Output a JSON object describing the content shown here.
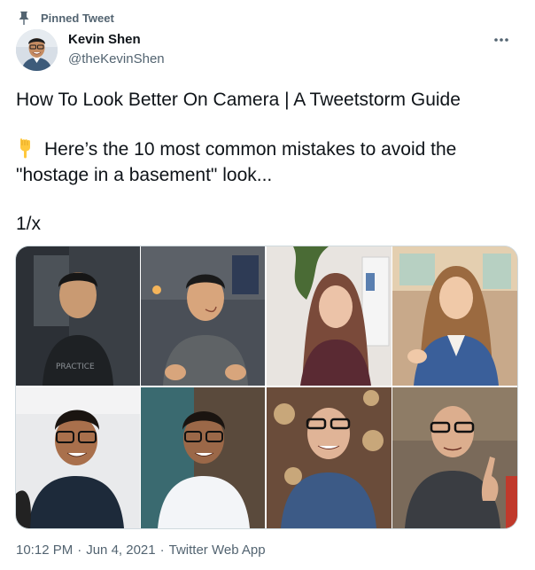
{
  "pinned": {
    "label": "Pinned Tweet",
    "icon": "pin-icon"
  },
  "author": {
    "name": "Kevin Shen",
    "handle": "@theKevinShen",
    "avatar": "avatar-photo"
  },
  "tweet": {
    "line1": "How To Look Better On Camera | A Tweetstorm Guide",
    "line2": "Here’s the 10 most common mistakes to avoid the \"hostage in a basement\" look...",
    "line2_emoji": "backhand-index-pointing-down-emoji",
    "line3": "1/x"
  },
  "media": [
    {
      "alt": "video call comparison photo 1"
    },
    {
      "alt": "video call comparison photo 2"
    },
    {
      "alt": "video call comparison photo 3"
    },
    {
      "alt": "video call comparison photo 4"
    }
  ],
  "meta": {
    "time": "10:12 PM",
    "date": "Jun 4, 2021",
    "source": "Twitter Web App",
    "separator": "·"
  },
  "colors": {
    "text": "#0f1419",
    "secondary": "#536471",
    "border": "#cfd9de"
  }
}
